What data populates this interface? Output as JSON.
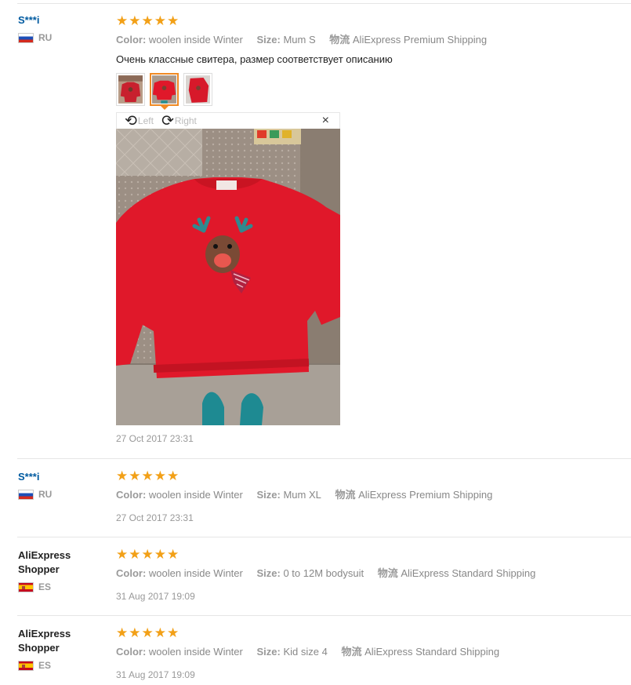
{
  "labels": {
    "color": "Color:",
    "size": "Size:",
    "logistics": "物流"
  },
  "reviews": [
    {
      "user": "S***i",
      "country": "RU",
      "color_value": "woolen inside Winter",
      "size_value": "Mum S",
      "shipping": "AliExpress Premium Shipping",
      "text": "Очень классные свитера, размер соответствует описанию",
      "time": "27 Oct 2017 23:31"
    },
    {
      "user": "S***i",
      "country": "RU",
      "color_value": "woolen inside Winter",
      "size_value": "Mum XL",
      "shipping": "AliExpress Premium Shipping",
      "time": "27 Oct 2017 23:31"
    },
    {
      "user": "AliExpress Shopper",
      "country": "ES",
      "color_value": "woolen inside Winter",
      "size_value": "0 to 12M bodysuit",
      "shipping": "AliExpress Standard Shipping",
      "time": "31 Aug 2017 19:09"
    },
    {
      "user": "AliExpress Shopper",
      "country": "ES",
      "color_value": "woolen inside Winter",
      "size_value": "Kid size 4",
      "shipping": "AliExpress Standard Shipping",
      "time": "31 Aug 2017 19:09"
    }
  ],
  "rating": 5,
  "viewer": {
    "left_label": "Left",
    "right_label": "Right",
    "close_glyph": "×",
    "rotate_left_glyph": "⟲",
    "rotate_right_glyph": "⟳"
  },
  "star_glyph": "★",
  "colors": {
    "link": "#005aa0",
    "star": "#f2a017",
    "active_thumb": "#f08a24",
    "sweater": "#e0182a"
  }
}
